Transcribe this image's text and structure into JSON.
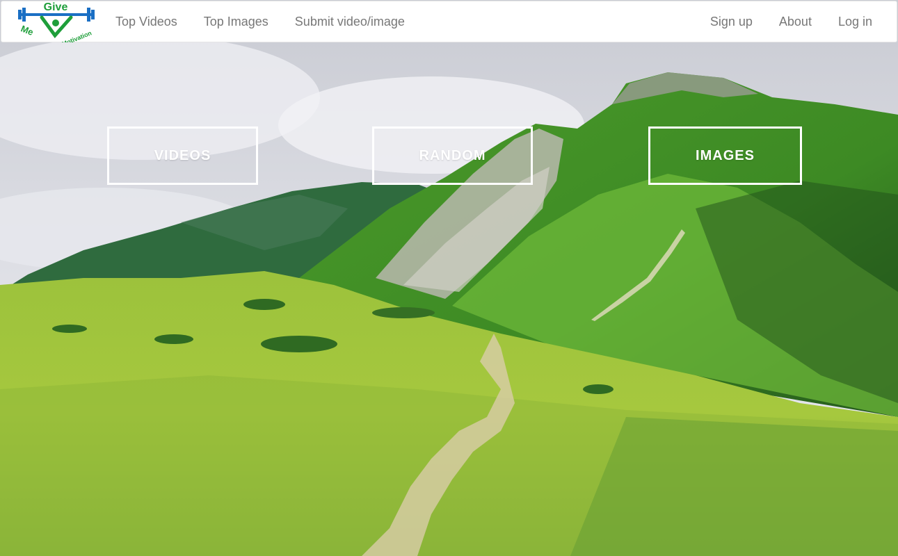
{
  "brand": {
    "logo_text_top": "Give",
    "logo_text_left": "Me",
    "logo_text_right": "Motivation",
    "colors": {
      "green": "#1e9e3a",
      "blue": "#1a6fc4"
    }
  },
  "nav": {
    "left": [
      {
        "label": "Top Videos"
      },
      {
        "label": "Top Images"
      },
      {
        "label": "Submit video/image"
      }
    ],
    "right": [
      {
        "label": "Sign up"
      },
      {
        "label": "About"
      },
      {
        "label": "Log in"
      }
    ]
  },
  "hero": {
    "buttons": {
      "videos": "VIDEOS",
      "random": "RANDOM",
      "images": "IMAGES"
    }
  },
  "colors": {
    "nav_text": "#777777",
    "button_border": "#ffffff"
  }
}
